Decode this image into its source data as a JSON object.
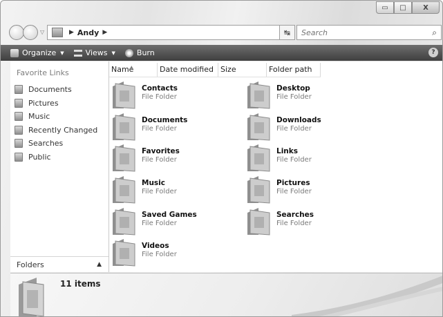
{
  "window": {
    "caption": {
      "min": "▭",
      "max": "□",
      "close": "X"
    }
  },
  "nav": {
    "breadcrumb": [
      "Andy"
    ],
    "search_placeholder": "Search"
  },
  "toolbar": {
    "organize": "Organize",
    "views": "Views",
    "burn": "Burn",
    "help": "?"
  },
  "sidebar": {
    "header": "Favorite Links",
    "links": [
      {
        "label": "Documents",
        "icon": "documents-icon"
      },
      {
        "label": "Pictures",
        "icon": "pictures-icon"
      },
      {
        "label": "Music",
        "icon": "music-icon"
      },
      {
        "label": "Recently Changed",
        "icon": "recently-changed-icon"
      },
      {
        "label": "Searches",
        "icon": "searches-icon"
      },
      {
        "label": "Public",
        "icon": "public-icon"
      }
    ],
    "folders_label": "Folders"
  },
  "columns": [
    "Name",
    "Date modified",
    "Size",
    "Folder path"
  ],
  "items": [
    {
      "name": "Contacts",
      "type": "File Folder",
      "icon": "contacts-folder-icon"
    },
    {
      "name": "Desktop",
      "type": "File Folder",
      "icon": "desktop-folder-icon"
    },
    {
      "name": "Documents",
      "type": "File Folder",
      "icon": "documents-folder-icon"
    },
    {
      "name": "Downloads",
      "type": "File Folder",
      "icon": "downloads-folder-icon"
    },
    {
      "name": "Favorites",
      "type": "File Folder",
      "icon": "favorites-folder-icon"
    },
    {
      "name": "Links",
      "type": "File Folder",
      "icon": "links-folder-icon"
    },
    {
      "name": "Music",
      "type": "File Folder",
      "icon": "music-folder-icon"
    },
    {
      "name": "Pictures",
      "type": "File Folder",
      "icon": "pictures-folder-icon"
    },
    {
      "name": "Saved Games",
      "type": "File Folder",
      "icon": "saved-games-folder-icon"
    },
    {
      "name": "Searches",
      "type": "File Folder",
      "icon": "searches-folder-icon"
    },
    {
      "name": "Videos",
      "type": "File Folder",
      "icon": "videos-folder-icon"
    }
  ],
  "details": {
    "count": "11 items"
  }
}
